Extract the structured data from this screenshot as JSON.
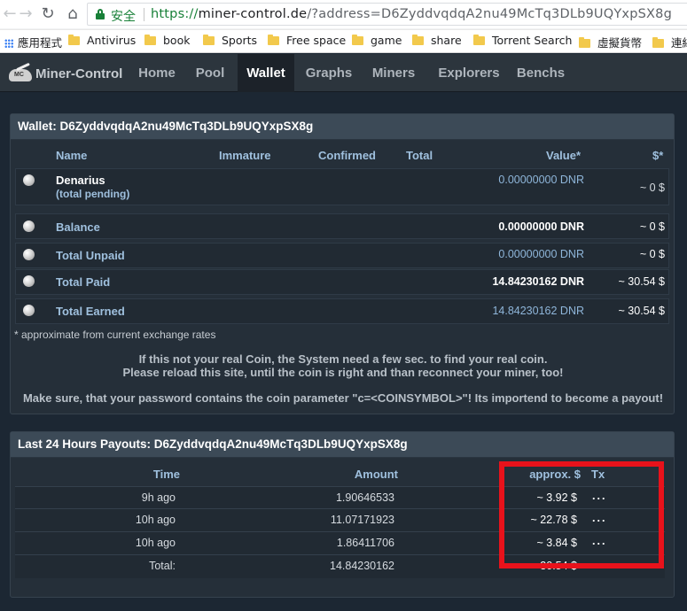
{
  "browser": {
    "secure_label": "安全",
    "url_scheme": "https://",
    "url_host": "miner-control.de",
    "url_rest": "/?address=D6ZyddvqdqA2nu49McTq3DLb9UQYxpSX8g",
    "bookmarks": [
      {
        "label": "應用程式",
        "icon": "apps-icon"
      },
      {
        "label": "Antivirus",
        "icon": "folder-icon"
      },
      {
        "label": "book",
        "icon": "folder-icon"
      },
      {
        "label": "Sports",
        "icon": "folder-icon"
      },
      {
        "label": "Free space",
        "icon": "folder-icon"
      },
      {
        "label": "game",
        "icon": "folder-icon"
      },
      {
        "label": "share",
        "icon": "folder-icon"
      },
      {
        "label": "Torrent Search",
        "icon": "folder-icon"
      },
      {
        "label": "虛擬貨幣",
        "icon": "folder-icon"
      },
      {
        "label": "連結",
        "icon": "folder-icon"
      }
    ]
  },
  "navbar": {
    "brand": "Miner-Control",
    "items": [
      "Home",
      "Pool",
      "Wallet",
      "Graphs",
      "Miners",
      "Explorers",
      "Benchs"
    ],
    "active": "Wallet"
  },
  "wallet": {
    "title": "Wallet: D6ZyddvqdqA2nu49McTq3DLb9UQYxpSX8g",
    "columns": {
      "name": "Name",
      "immature": "Immature",
      "confirmed": "Confirmed",
      "total": "Total",
      "value": "Value*",
      "usd": "$*"
    },
    "coin_row": {
      "name": "Denarius",
      "sub": "(total pending)",
      "value": "0.00000000 DNR",
      "usd": "~ 0 $"
    },
    "rows": [
      {
        "label": "Balance",
        "value": "0.00000000 DNR",
        "usd": "~ 0 $"
      },
      {
        "label": "Total Unpaid",
        "value": "0.00000000 DNR",
        "usd": "~ 0 $"
      },
      {
        "label": "Total Paid",
        "value": "14.84230162 DNR",
        "usd": "~ 30.54 $"
      },
      {
        "label": "Total Earned",
        "value": "14.84230162 DNR",
        "usd": "~ 30.54 $"
      }
    ],
    "footnote": "* approximate from current exchange rates",
    "message_line1": "If this not your real Coin, the System need a few sec. to find your real coin.",
    "message_line2": "Please reload this site, until the coin is right and than reconnect your miner, too!",
    "message_line3": "Make sure, that your password contains the coin parameter \"c=<COINSYMBOL>\"! Its importend to become a payout!"
  },
  "payouts": {
    "title": "Last 24 Hours Payouts: D6ZyddvqdqA2nu49McTq3DLb9UQYxpSX8g",
    "columns": {
      "time": "Time",
      "amount": "Amount",
      "approx": "approx. $",
      "tx": "Tx"
    },
    "rows": [
      {
        "time": "9h ago",
        "amount": "1.90646533",
        "approx": "~ 3.92 $",
        "tx": "..."
      },
      {
        "time": "10h ago",
        "amount": "11.07171923",
        "approx": "~ 22.78 $",
        "tx": "..."
      },
      {
        "time": "10h ago",
        "amount": "1.86411706",
        "approx": "~ 3.84 $",
        "tx": "..."
      }
    ],
    "total_label": "Total:",
    "total_amount": "14.84230162",
    "total_approx": "~30.54 $"
  },
  "colors": {
    "background": "#1c2733",
    "navbar": "#2c353d",
    "panel_head": "#3c4a57",
    "highlight_box": "#e8121b"
  }
}
